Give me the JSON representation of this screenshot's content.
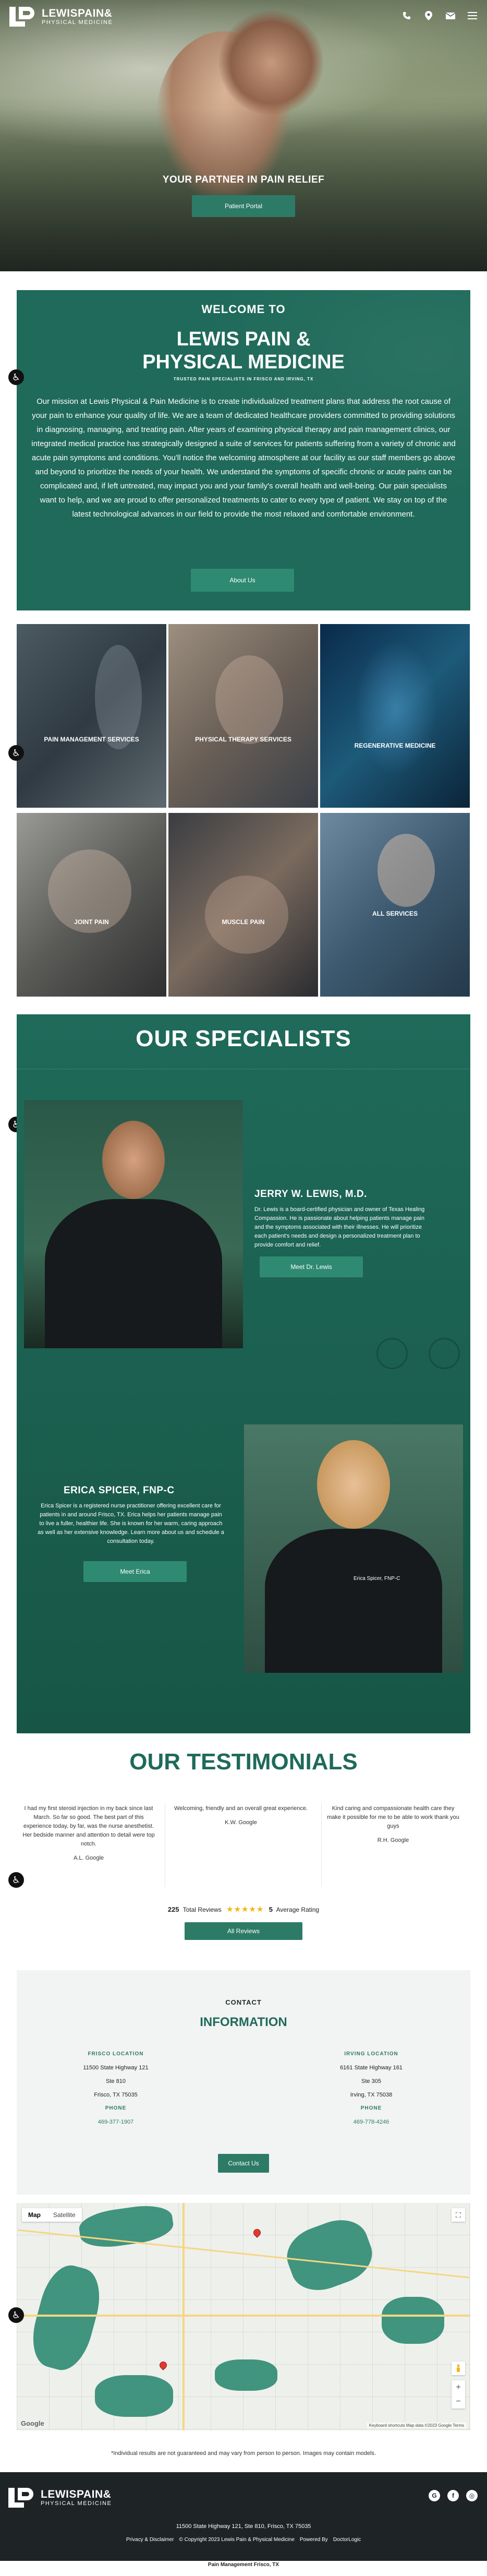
{
  "header": {
    "logo_name": "LEWISPAIN&",
    "logo_sub": "PHYSICAL MEDICINE",
    "icons": [
      "phone-icon",
      "location-icon",
      "email-icon",
      "menu-icon"
    ]
  },
  "hero": {
    "tagline": "YOUR PARTNER IN PAIN RELIEF",
    "button": "Patient Portal"
  },
  "welcome": {
    "kicker": "WELCOME TO",
    "title_line1": "LEWIS PAIN &",
    "title_line2": "PHYSICAL MEDICINE",
    "subtitle": "TRUSTED PAIN SPECIALISTS IN FRISCO AND IRVING, TX",
    "body": "Our mission at Lewis Physical & Pain Medicine is to create individualized treatment plans that address the root cause of your pain to enhance your quality of life. We are a team of dedicated healthcare providers committed to providing solutions in diagnosing, managing, and treating pain. After years of examining physical therapy and pain management clinics, our integrated medical practice has strategically designed a suite of services for patients suffering from a variety of chronic and acute pain symptoms and conditions. You'll notice the welcoming atmosphere at our facility as our staff members go above and beyond to prioritize the needs of your health. We understand the symptoms of specific chronic or acute pains can be complicated and, if left untreated, may impact you and your family's overall health and well-being. Our pain specialists want to help, and we are proud to offer personalized treatments to cater to every type of patient. We stay on top of the latest technological advances in our field to provide the most relaxed and comfortable environment.",
    "button": "About Us"
  },
  "services": [
    {
      "label": "PAIN MANAGEMENT SERVICES"
    },
    {
      "label": "PHYSICAL THERAPY SERVICES"
    },
    {
      "label": "REGENERATIVE MEDICINE"
    },
    {
      "label": "JOINT PAIN"
    },
    {
      "label": "MUSCLE PAIN"
    },
    {
      "label": "ALL SERVICES"
    }
  ],
  "specialists": {
    "title": "OUR SPECIALISTS",
    "people": [
      {
        "name": "JERRY W. LEWIS, M.D.",
        "bio": "Dr. Lewis is a board-certified physician and owner of Texas Healing Compassion. He is passionate about helping patients manage pain and the symptoms associated with their illnesses. He will prioritize each patient's needs and design a personalized treatment plan to provide comfort and relief.",
        "button": "Meet Dr. Lewis"
      },
      {
        "name": "ERICA SPICER, FNP-C",
        "bio": "Erica Spicer is a registered nurse practitioner offering excellent care for patients in and around Frisco, TX. Erica helps her patients manage pain to live a fuller, healthier life. She is known for her warm, caring approach as well as her extensive knowledge. Learn more about us and schedule a consultation today.",
        "button": "Meet Erica",
        "shirt": "Erica Spicer, FNP-C"
      }
    ]
  },
  "testimonials": {
    "title": "OUR TESTIMONIALS",
    "items": [
      {
        "text": "I had my first steroid injection in my back since last March. So far so good. The best part of this experience today, by far, was the nurse anesthetist. Her bedside manner and attention to detail were top notch.",
        "author": "A.L. Google"
      },
      {
        "text": "Welcoming, friendly and an overall great experience.",
        "author": "K.W. Google"
      },
      {
        "text": "Kind caring and compassionate health care they make it possible for me to be able to work thank you guys",
        "author": "R.H. Google"
      }
    ],
    "total_count": "225",
    "total_label": "Total Reviews",
    "stars": "★★★★★",
    "rating_value": "5",
    "rating_label": "Average Rating",
    "button": "All Reviews"
  },
  "contact": {
    "kicker": "CONTACT",
    "title": "INFORMATION",
    "locations": [
      {
        "title": "FRISCO LOCATION",
        "street": "11500 State Highway 121",
        "suite": "Ste 810",
        "city": "Frisco, TX 75035",
        "phone_label": "PHONE",
        "phone": "469-377-1907"
      },
      {
        "title": "IRVING LOCATION",
        "street": "6161 State Highway 161",
        "suite": "Ste 305",
        "city": "Irving, TX 75038",
        "phone_label": "PHONE",
        "phone": "469-778-4246"
      }
    ],
    "button": "Contact Us"
  },
  "map": {
    "tab_map": "Map",
    "tab_satellite": "Satellite",
    "google": "Google",
    "attribution": "Keyboard shortcuts   Map data ©2023 Google   Terms"
  },
  "disclaimer": "*Individual results are not guaranteed and may vary from person to person. Images may contain models.",
  "footer": {
    "address": "11500 State Highway 121,  Ste 810,  Frisco, TX 75035",
    "privacy": "Privacy & Disclaimer",
    "copyright": "© Copyright 2023 Lewis Pain & Physical Medicine",
    "powered": "Powered By",
    "powered_brand": "DoctorLogic",
    "bottom": "Pain Management Frisco, TX",
    "social": [
      "G",
      "f",
      "◎"
    ]
  },
  "colors": {
    "brand_green": "#1f6a5a",
    "button_green": "#2d7b66",
    "star": "#f4b400",
    "footer": "#1e2326"
  }
}
